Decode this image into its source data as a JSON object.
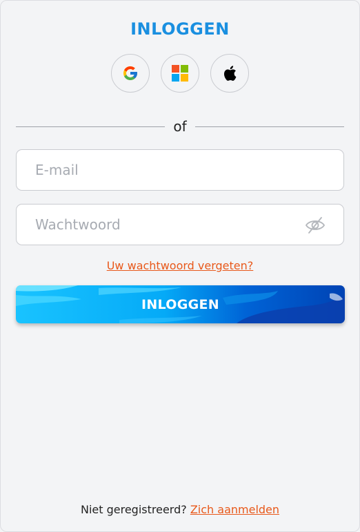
{
  "header": {
    "title": "INLOGGEN"
  },
  "social": [
    {
      "icon": "google-icon"
    },
    {
      "icon": "microsoft-icon"
    },
    {
      "icon": "apple-icon"
    }
  ],
  "divider": {
    "text": "of"
  },
  "email": {
    "placeholder": "E-mail",
    "value": ""
  },
  "password": {
    "placeholder": "Wachtwoord",
    "value": "",
    "toggle_icon": "eye-slash-icon"
  },
  "forgot_link": "Uw wachtwoord vergeten?",
  "login_button": "INLOGGEN",
  "footer": {
    "prompt": "Niet geregistreerd?",
    "link": "Zich aanmelden"
  },
  "colors": {
    "accent": "#1a8fe0",
    "link": "#e8581a",
    "background": "#f3f4f6"
  }
}
